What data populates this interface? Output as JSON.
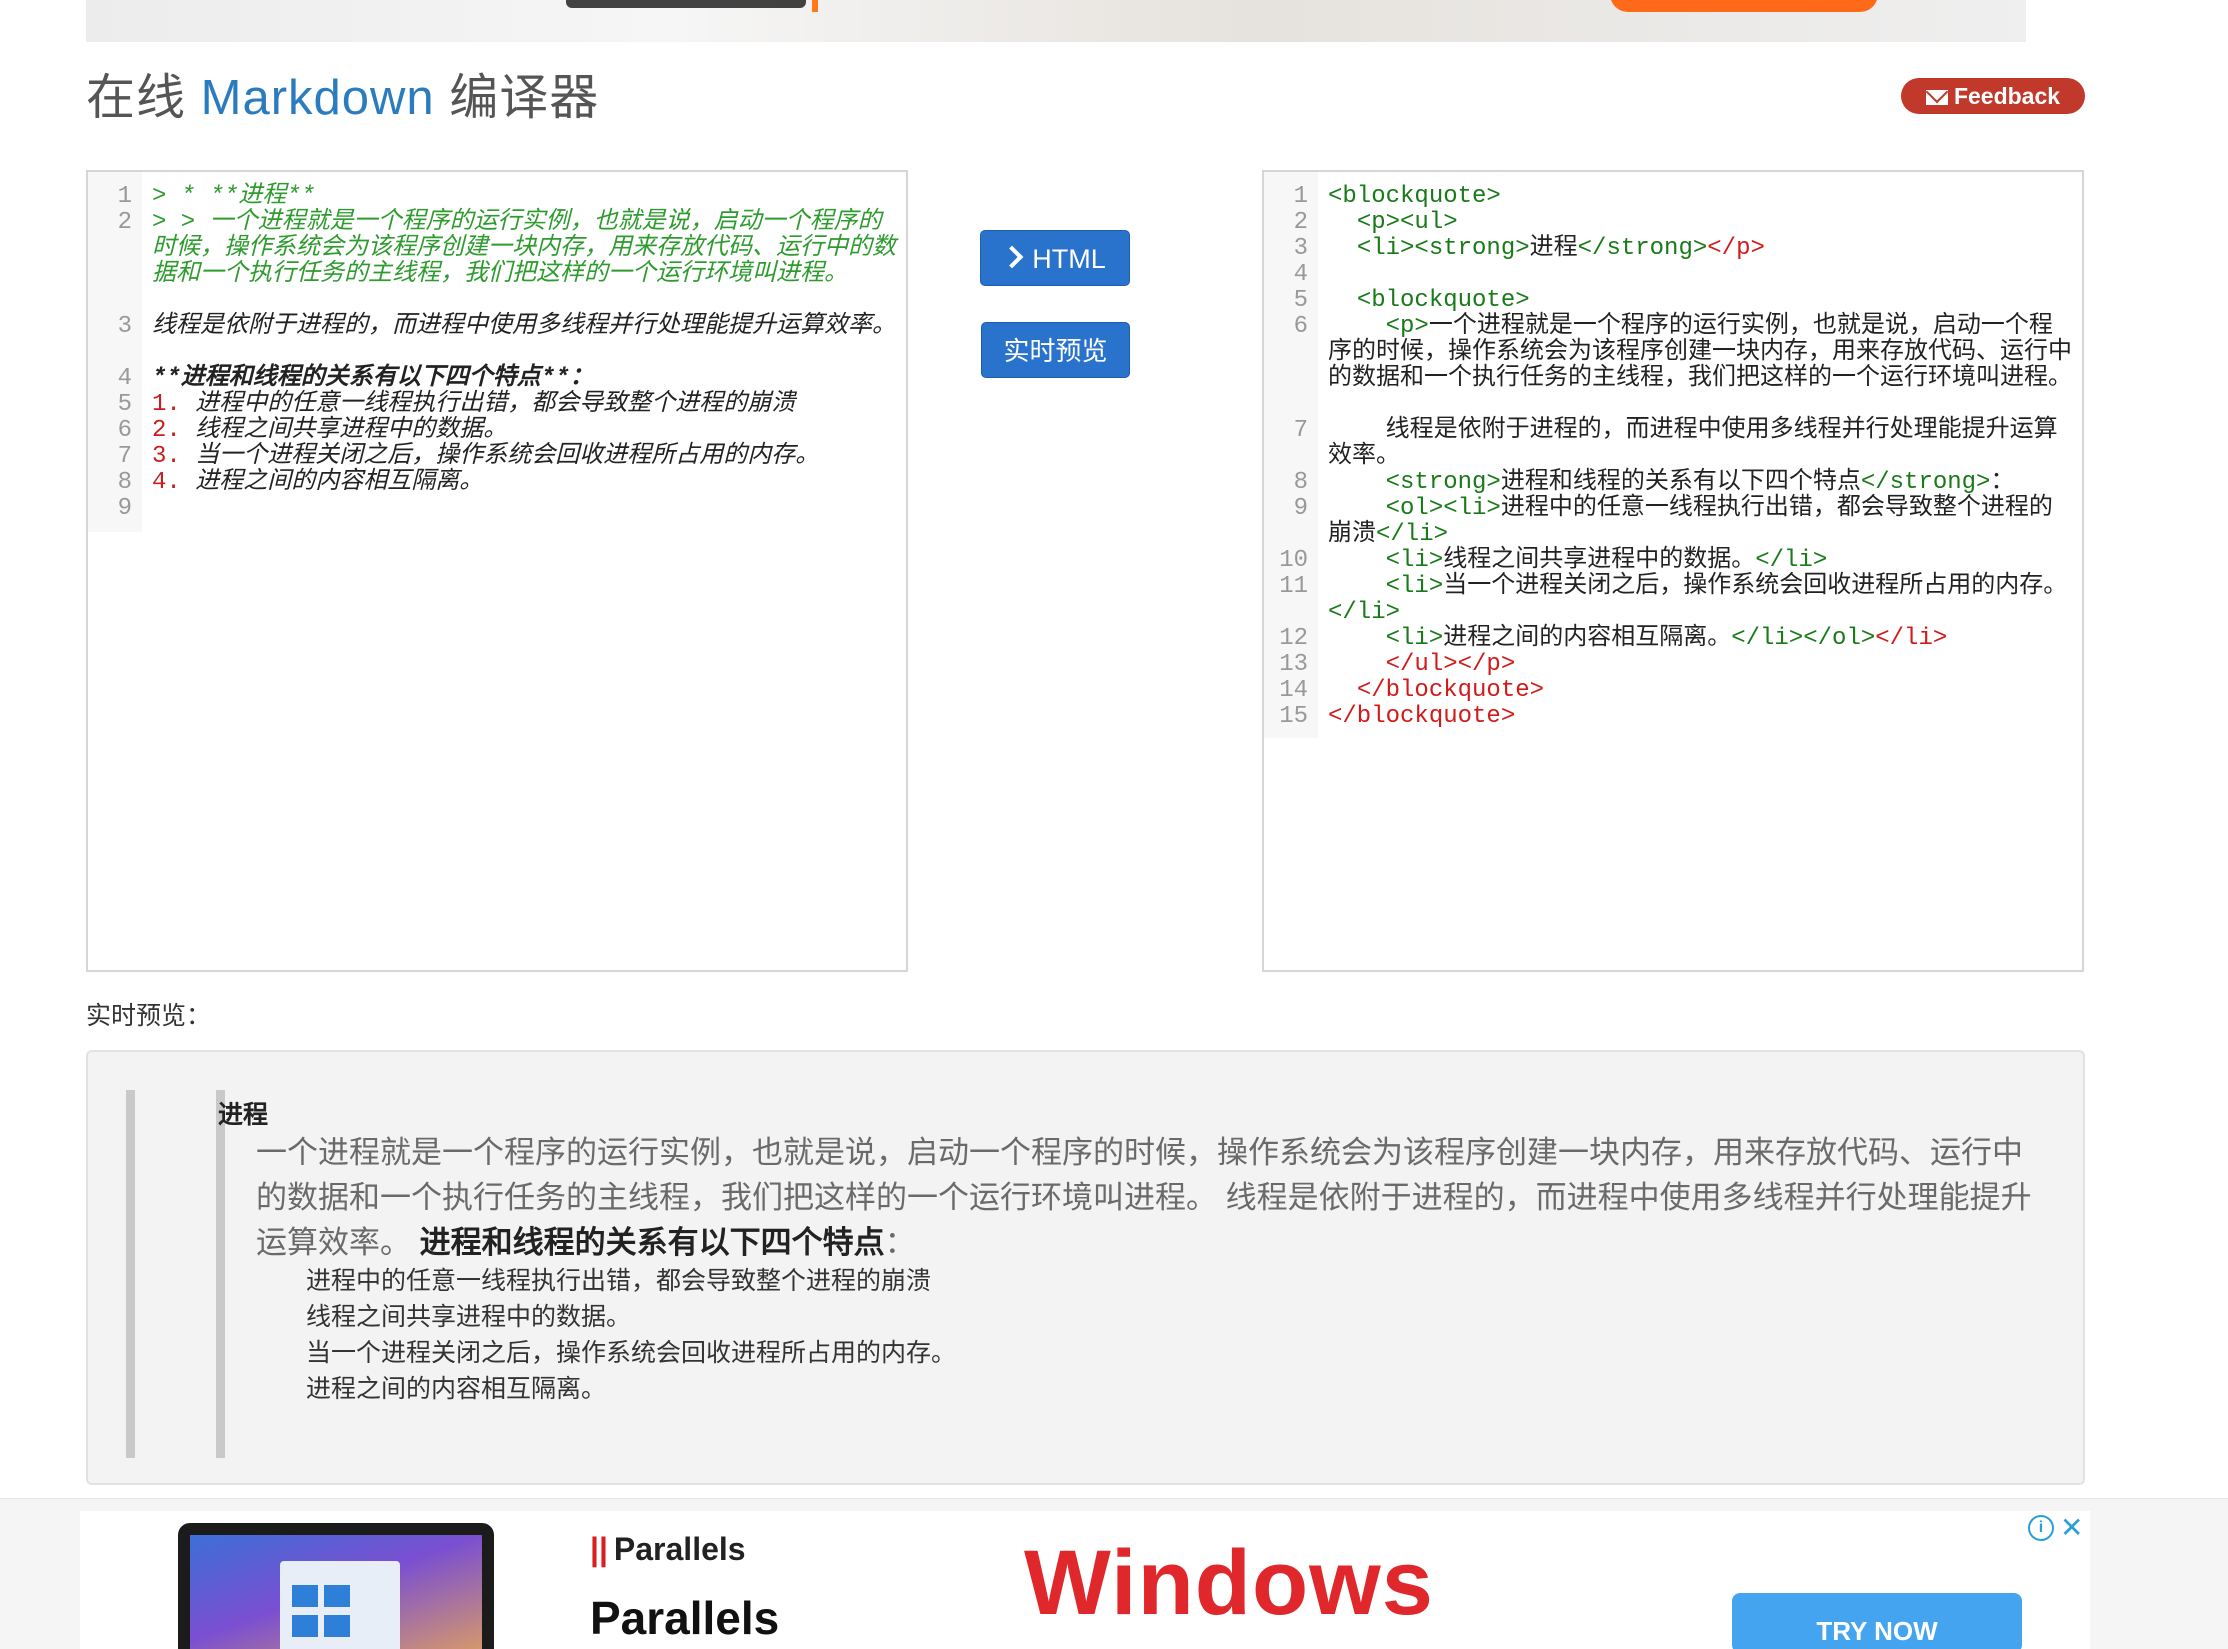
{
  "header": {
    "title_prefix": "在线",
    "title_accent": "Markdown",
    "title_suffix": "编译器",
    "feedback_label": "Feedback"
  },
  "colors": {
    "accent": "#2b7bbf",
    "feedback": "#c0392b",
    "button": "#2a73cc",
    "md_quote": "#2e9b2e",
    "html_tag": "#197a19",
    "html_red": "#d21a1a"
  },
  "editor_left": {
    "lines": [
      {
        "num": "1",
        "segs": [
          {
            "t": "> * **进程**",
            "c": "md-quote"
          }
        ]
      },
      {
        "num": "2",
        "segs": [
          {
            "t": "> > 一个进程就是一个程序的运行实例，也就是说，启动一个程序的时候，操作系统会为该程序创建一块内存，用来存放代码、运行中的数据和一个执行任务的主线程，我们把这样的一个运行环境叫进程。",
            "c": "md-quote"
          }
        ]
      },
      {
        "num": "3",
        "segs": [
          {
            "t": "线程是依附于进程的，而进程中使用多线程并行处理能提升运算效率。",
            "c": "md-text"
          }
        ]
      },
      {
        "num": "4",
        "segs": [
          {
            "t": "**进程和线程的关系有以下四个特点**：",
            "c": "md-strong"
          }
        ]
      },
      {
        "num": "5",
        "segs": [
          {
            "t": "1. ",
            "c": "md-num"
          },
          {
            "t": "进程中的任意一线程执行出错，都会导致整个进程的崩溃",
            "c": "md-text"
          }
        ]
      },
      {
        "num": "6",
        "segs": [
          {
            "t": "2. ",
            "c": "md-num"
          },
          {
            "t": "线程之间共享进程中的数据。",
            "c": "md-text"
          }
        ]
      },
      {
        "num": "7",
        "segs": [
          {
            "t": "3. ",
            "c": "md-num"
          },
          {
            "t": "当一个进程关闭之后，操作系统会回收进程所占用的内存。",
            "c": "md-text"
          }
        ]
      },
      {
        "num": "8",
        "segs": [
          {
            "t": "4. ",
            "c": "md-num"
          },
          {
            "t": "进程之间的内容相互隔离。",
            "c": "md-text"
          }
        ]
      },
      {
        "num": "9",
        "segs": [
          {
            "t": "",
            "c": "md-text"
          }
        ]
      }
    ]
  },
  "editor_right": {
    "lines": [
      {
        "num": "1",
        "segs": [
          {
            "t": "<blockquote>",
            "c": "html-tag"
          }
        ]
      },
      {
        "num": "2",
        "segs": [
          {
            "t": "  <p><ul>",
            "c": "html-tag"
          }
        ]
      },
      {
        "num": "3",
        "segs": [
          {
            "t": "  <li><strong>",
            "c": "html-tag"
          },
          {
            "t": "进程",
            "c": "html-text"
          },
          {
            "t": "</strong>",
            "c": "html-tag"
          },
          {
            "t": "</p>",
            "c": "html-red"
          }
        ]
      },
      {
        "num": "4",
        "segs": [
          {
            "t": "",
            "c": "html-text"
          }
        ]
      },
      {
        "num": "5",
        "segs": [
          {
            "t": "  <blockquote>",
            "c": "html-tag"
          }
        ]
      },
      {
        "num": "6",
        "segs": [
          {
            "t": "    <p>",
            "c": "html-tag"
          },
          {
            "t": "一个进程就是一个程序的运行实例，也就是说，启动一个程序的时候，操作系统会为该程序创建一块内存，用来存放代码、运行中的数据和一个执行任务的主线程，我们把这样的一个运行环境叫进程。",
            "c": "html-text"
          }
        ]
      },
      {
        "num": "7",
        "segs": [
          {
            "t": "    线程是依附于进程的，而进程中使用多线程并行处理能提升运算效率。",
            "c": "html-text"
          }
        ]
      },
      {
        "num": "8",
        "segs": [
          {
            "t": "    <strong>",
            "c": "html-tag"
          },
          {
            "t": "进程和线程的关系有以下四个特点",
            "c": "html-text"
          },
          {
            "t": "</strong>",
            "c": "html-tag"
          },
          {
            "t": "：",
            "c": "html-text"
          }
        ]
      },
      {
        "num": "9",
        "segs": [
          {
            "t": "    <ol><li>",
            "c": "html-tag"
          },
          {
            "t": "进程中的任意一线程执行出错，都会导致整个进程的崩溃",
            "c": "html-text"
          },
          {
            "t": "</li>",
            "c": "html-tag"
          }
        ]
      },
      {
        "num": "10",
        "segs": [
          {
            "t": "    <li>",
            "c": "html-tag"
          },
          {
            "t": "线程之间共享进程中的数据。",
            "c": "html-text"
          },
          {
            "t": "</li>",
            "c": "html-tag"
          }
        ]
      },
      {
        "num": "11",
        "segs": [
          {
            "t": "    <li>",
            "c": "html-tag"
          },
          {
            "t": "当一个进程关闭之后，操作系统会回收进程所占用的内存。",
            "c": "html-text"
          },
          {
            "t": "</li>",
            "c": "html-tag"
          }
        ]
      },
      {
        "num": "12",
        "segs": [
          {
            "t": "    <li>",
            "c": "html-tag"
          },
          {
            "t": "进程之间的内容相互隔离。",
            "c": "html-text"
          },
          {
            "t": "</li></ol>",
            "c": "html-tag"
          },
          {
            "t": "</li>",
            "c": "html-red"
          }
        ]
      },
      {
        "num": "13",
        "segs": [
          {
            "t": "    </ul></p>",
            "c": "html-red"
          }
        ]
      },
      {
        "num": "14",
        "segs": [
          {
            "t": "  </blockquote>",
            "c": "html-red"
          }
        ]
      },
      {
        "num": "15",
        "segs": [
          {
            "t": "</blockquote>",
            "c": "html-red"
          }
        ]
      }
    ]
  },
  "actions": {
    "html_button": "HTML",
    "live_button": "实时预览"
  },
  "preview": {
    "label": "实时预览：",
    "heading": "进程",
    "para_main": "一个进程就是一个程序的运行实例，也就是说，启动一个程序的时候，操作系统会为该程序创建一块内存，用来存放代码、运行中的数据和一个执行任务的主线程，我们把这样的一个运行环境叫进程。 线程是依附于进程的，而进程中使用多线程并行处理能提升运算效率。",
    "para_strong": "进程和线程的关系有以下四个特点",
    "para_tail": "：",
    "list": [
      "进程中的任意一线程执行出错，都会导致整个进程的崩溃",
      "线程之间共享进程中的数据。",
      "当一个进程关闭之后，操作系统会回收进程所占用的内存。",
      "进程之间的内容相互隔离。"
    ]
  },
  "ad": {
    "brand_small": "Parallels",
    "brand_big": "Parallels",
    "headline": "Windows",
    "cta": "TRY NOW",
    "info_icon": "i",
    "close_icon": "✕"
  }
}
